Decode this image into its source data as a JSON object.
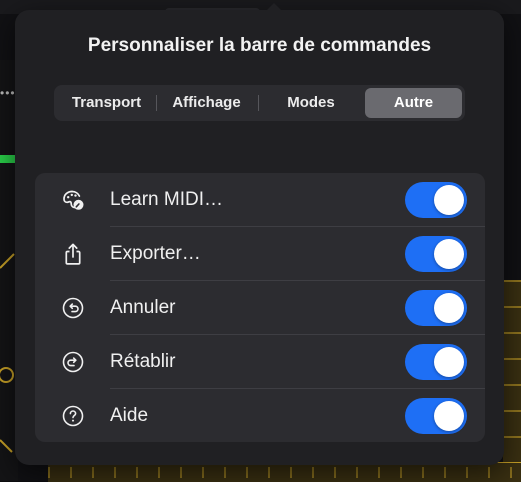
{
  "popover": {
    "title": "Personnaliser la barre de commandes"
  },
  "tabs": [
    {
      "label": "Transport",
      "selected": false
    },
    {
      "label": "Affichage",
      "selected": false
    },
    {
      "label": "Modes",
      "selected": false
    },
    {
      "label": "Autre",
      "selected": true
    }
  ],
  "items": [
    {
      "label": "Learn MIDI…",
      "icon": "midi-learn-icon",
      "enabled": true
    },
    {
      "label": "Exporter…",
      "icon": "share-export-icon",
      "enabled": true
    },
    {
      "label": "Annuler",
      "icon": "undo-icon",
      "enabled": true
    },
    {
      "label": "Rétablir",
      "icon": "redo-icon",
      "enabled": true
    },
    {
      "label": "Aide",
      "icon": "help-icon",
      "enabled": true
    }
  ],
  "colors": {
    "toggle_on": "#1e6ff5",
    "popover_bg": "#202023",
    "table_bg": "#2c2c30",
    "selected_tab": "#6a6a6f"
  }
}
